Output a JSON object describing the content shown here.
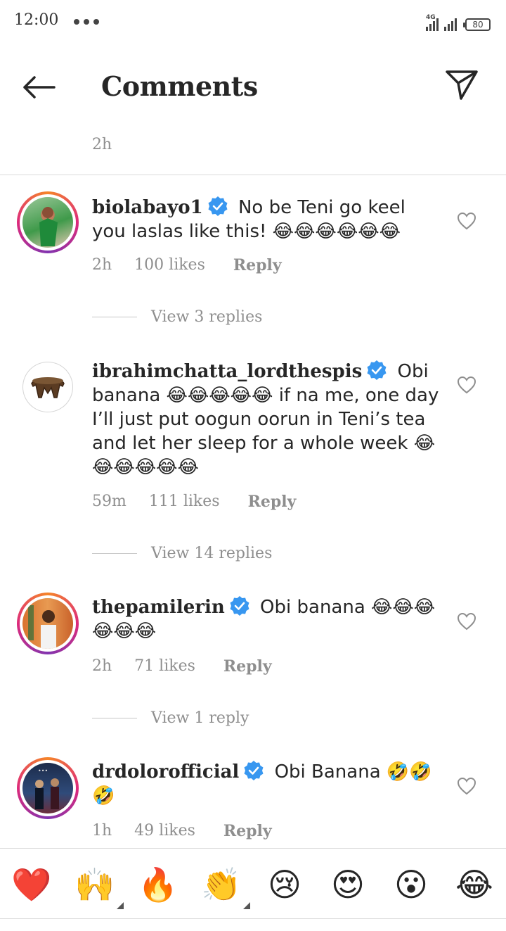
{
  "status_bar": {
    "time": "12:00",
    "network_label": "4G",
    "battery": "80"
  },
  "header": {
    "title": "Comments",
    "back_icon": "arrow-left-icon",
    "send_icon": "paper-plane-icon"
  },
  "previous_comment": {
    "time": "2h"
  },
  "comments": [
    {
      "username": "biolabayo1",
      "verified": true,
      "text": "No be Teni go keel you laslas like this! 😂😂😂😂😂😂",
      "time": "2h",
      "likes": "100 likes",
      "reply_label": "Reply",
      "view_replies": "View 3 replies",
      "story_ring": true
    },
    {
      "username": "ibrahimchatta_lordthespis",
      "verified": true,
      "text": "Obi banana 😂😂😂😂😂 if na me, one day I’ll just put oogun oorun in Teni’s tea and let her sleep for a whole week 😂😂😂😂😂😂",
      "time": "59m",
      "likes": "111 likes",
      "reply_label": "Reply",
      "view_replies": "View 14 replies",
      "story_ring": false
    },
    {
      "username": "thepamilerin",
      "verified": true,
      "text": "Obi banana 😂😂😂😂😂😂",
      "time": "2h",
      "likes": "71 likes",
      "reply_label": "Reply",
      "view_replies": "View 1 reply",
      "story_ring": true
    },
    {
      "username": "drdolorofficial",
      "verified": true,
      "text": "Obi Banana 🤣🤣🤣",
      "time": "1h",
      "likes": "49 likes",
      "reply_label": "Reply",
      "story_ring": true
    }
  ],
  "reactions": [
    "❤️",
    "🙌",
    "🔥",
    "👏",
    "😢",
    "😍",
    "😮",
    "😂"
  ],
  "colors": {
    "text": "#262626",
    "muted": "#8e8e8e",
    "verified_blue": "#3897f0",
    "divider": "#dbdbdb"
  }
}
